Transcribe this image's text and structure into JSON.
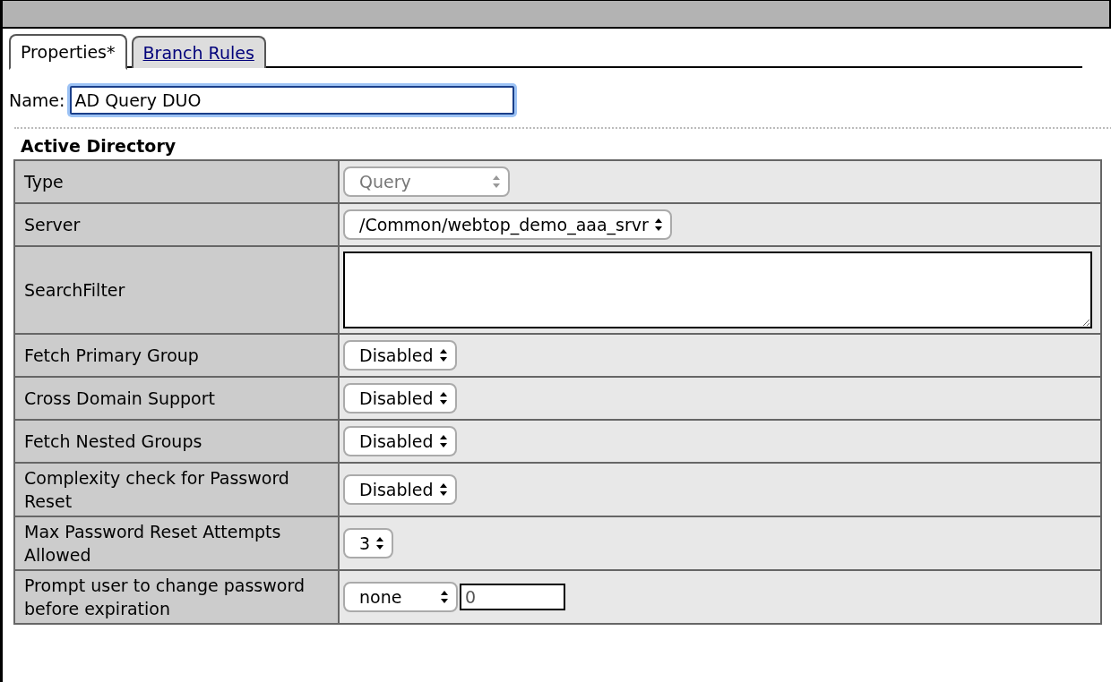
{
  "tabs": [
    {
      "label": "Properties*",
      "selected": true
    },
    {
      "label": "Branch Rules",
      "selected": false
    }
  ],
  "name_field": {
    "label": "Name:",
    "value": "AD Query DUO"
  },
  "section": {
    "title": "Active Directory"
  },
  "rows": [
    {
      "label": "Type",
      "kind": "select",
      "value": "Query",
      "disabled": true
    },
    {
      "label": "Server",
      "kind": "select",
      "value": "/Common/webtop_demo_aaa_srvr",
      "disabled": false
    },
    {
      "label": "SearchFilter",
      "kind": "textarea"
    },
    {
      "label": "Fetch Primary Group",
      "kind": "select",
      "value": "Disabled",
      "disabled": false
    },
    {
      "label": "Cross Domain Support",
      "kind": "select",
      "value": "Disabled",
      "disabled": false
    },
    {
      "label": "Fetch Nested Groups",
      "kind": "select",
      "value": "Disabled",
      "disabled": false
    },
    {
      "label": "Complexity check for Password Reset",
      "kind": "select",
      "value": "Disabled",
      "disabled": false
    },
    {
      "label": "Max Password Reset Attempts Allowed",
      "kind": "select",
      "value": "3",
      "disabled": false
    },
    {
      "label": "Prompt user to change password before expiration",
      "kind": "select_input",
      "value": "none",
      "input_value": "0",
      "disabled": false
    }
  ]
}
